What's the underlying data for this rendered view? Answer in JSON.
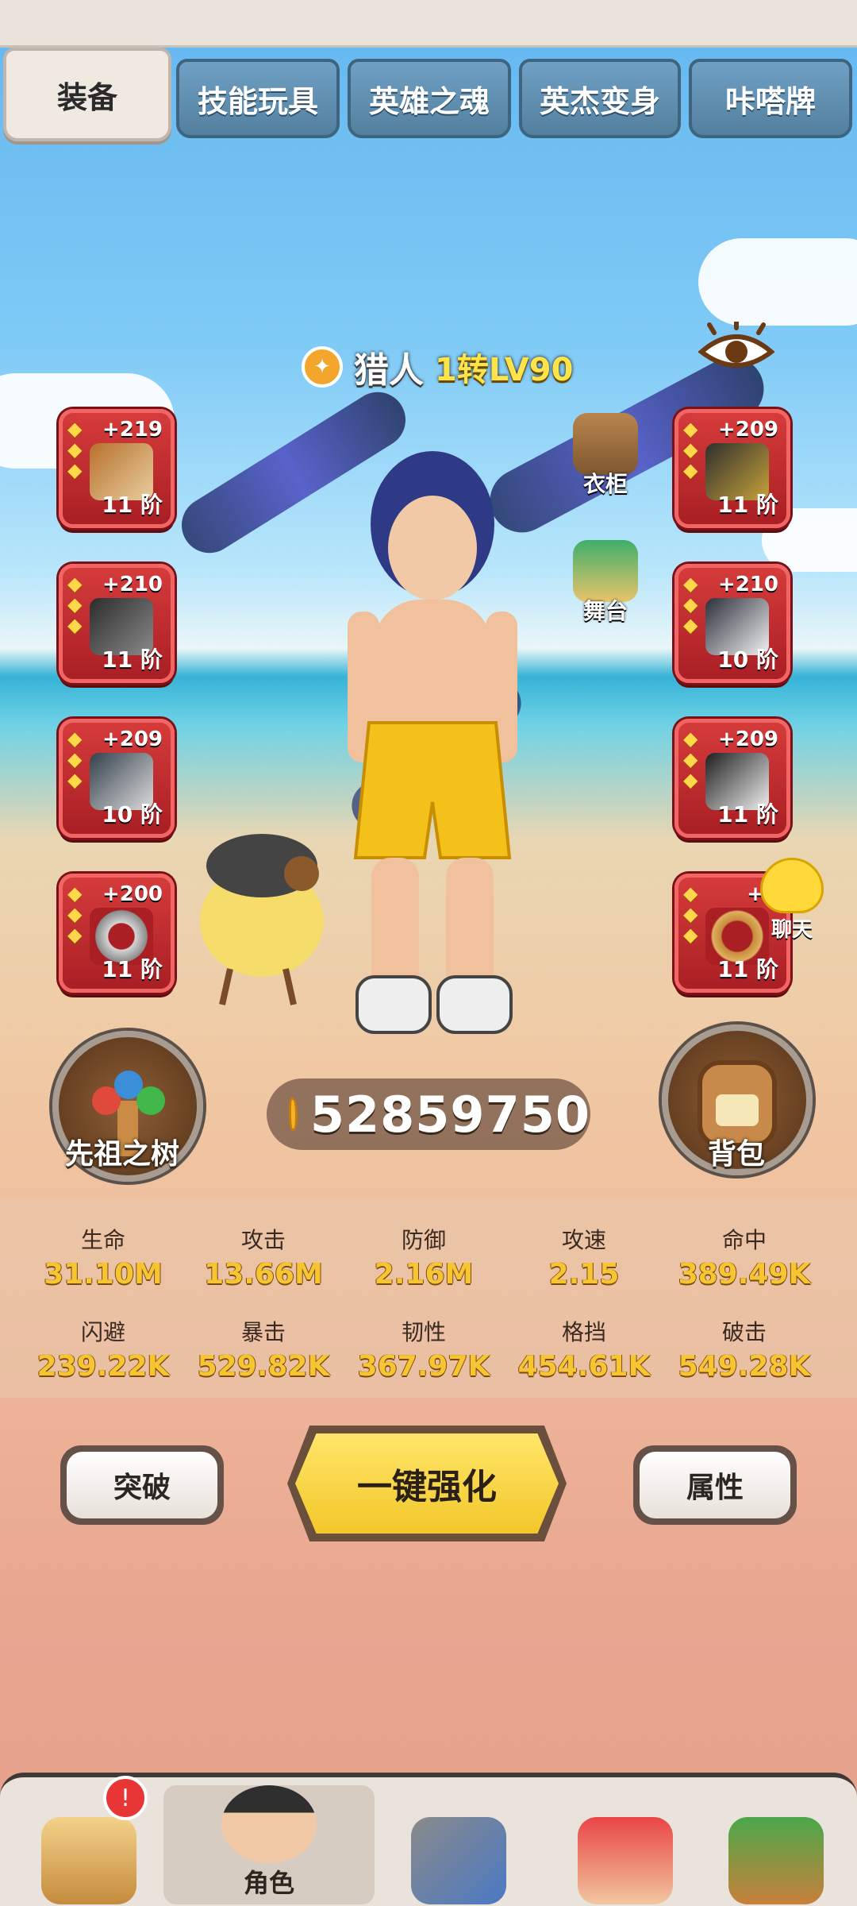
{
  "tabs": [
    {
      "label": "装备",
      "active": true
    },
    {
      "label": "技能玩具",
      "active": false
    },
    {
      "label": "英雄之魂",
      "active": false
    },
    {
      "label": "英杰变身",
      "active": false
    },
    {
      "label": "咔嗒牌",
      "active": false
    }
  ],
  "character": {
    "name": "猎人",
    "level": "1转LV90",
    "class_icon": "hunter-claw-icon"
  },
  "equipment": {
    "left": [
      {
        "plus": "+219",
        "tier": "11 阶",
        "icon": "bow-icon"
      },
      {
        "plus": "+210",
        "tier": "11 阶",
        "icon": "helmet-icon"
      },
      {
        "plus": "+209",
        "tier": "10 阶",
        "icon": "gauntlet-icon"
      },
      {
        "plus": "+200",
        "tier": "11 阶",
        "icon": "ring-icon"
      }
    ],
    "right": [
      {
        "plus": "+209",
        "tier": "11 阶",
        "icon": "arrow-quiver-icon"
      },
      {
        "plus": "+210",
        "tier": "10 阶",
        "icon": "armor-icon"
      },
      {
        "plus": "+209",
        "tier": "11 阶",
        "icon": "boots-icon"
      },
      {
        "plus": "+2",
        "tier": "11 阶",
        "icon": "necklace-icon"
      }
    ]
  },
  "side_buttons": {
    "wardrobe": "衣柜",
    "stage": "舞台",
    "chat": "聊天"
  },
  "ancestor_tree_label": "先祖之树",
  "backpack_label": "背包",
  "gold": "52859750",
  "stats": [
    {
      "label": "生命",
      "value": "31.10M"
    },
    {
      "label": "攻击",
      "value": "13.66M"
    },
    {
      "label": "防御",
      "value": "2.16M"
    },
    {
      "label": "攻速",
      "value": "2.15"
    },
    {
      "label": "命中",
      "value": "389.49K"
    },
    {
      "label": "闪避",
      "value": "239.22K"
    },
    {
      "label": "暴击",
      "value": "529.82K"
    },
    {
      "label": "韧性",
      "value": "367.97K"
    },
    {
      "label": "格挡",
      "value": "454.61K"
    },
    {
      "label": "破击",
      "value": "549.28K"
    }
  ],
  "actions": {
    "breakthrough": "突破",
    "one_click_enhance": "一键强化",
    "attributes": "属性"
  },
  "nav": [
    {
      "label": "",
      "icon": "chief-icon",
      "active": false,
      "badge": "!"
    },
    {
      "label": "角色",
      "icon": "role-icon",
      "active": true
    },
    {
      "label": "",
      "icon": "sword-icon",
      "active": false
    },
    {
      "label": "",
      "icon": "pet-dino-icon",
      "active": false
    },
    {
      "label": "",
      "icon": "totem-icon",
      "active": false
    }
  ],
  "colors": {
    "slot_red": "#c12b30",
    "stat_value_gold": "#f7c531",
    "enhance_yellow": "#f2c72a"
  }
}
